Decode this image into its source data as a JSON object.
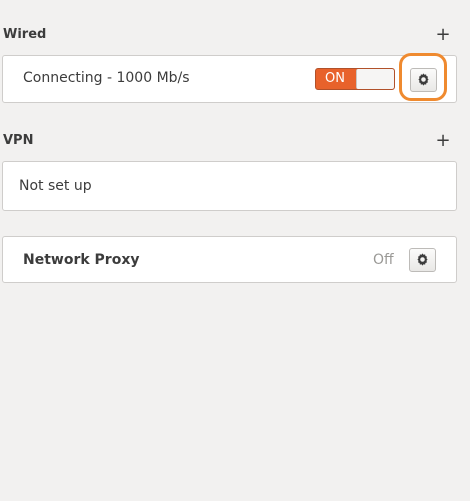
{
  "wired": {
    "header": "Wired",
    "add_symbol": "+",
    "connection_label": "Connecting - 1000 Mb/s",
    "toggle_label": "ON"
  },
  "vpn": {
    "header": "VPN",
    "add_symbol": "+",
    "status_text": "Not set up"
  },
  "proxy": {
    "label": "Network Proxy",
    "status": "Off"
  },
  "icons": {
    "settings": "gear-icon",
    "add": "plus-icon"
  },
  "colors": {
    "toggle_on": "#e8622b",
    "highlight": "#ef8a2f",
    "background": "#f2f1f0"
  }
}
